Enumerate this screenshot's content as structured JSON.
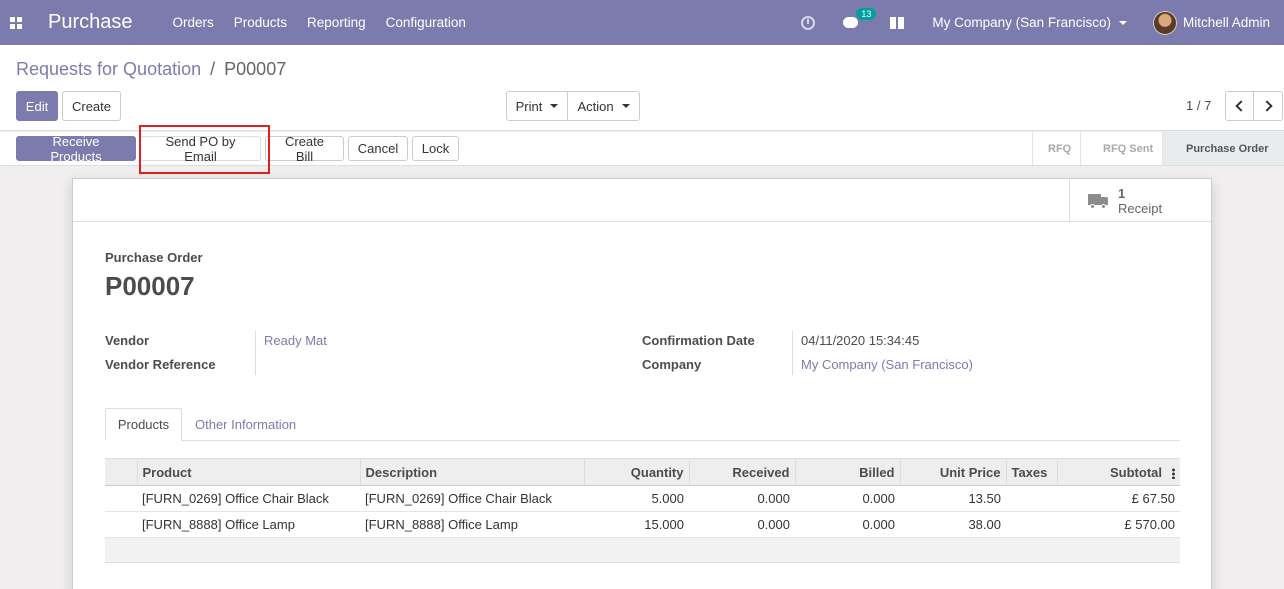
{
  "navbar": {
    "app_name": "Purchase",
    "menu": [
      "Orders",
      "Products",
      "Reporting",
      "Configuration"
    ],
    "message_count": "13",
    "company": "My Company (San Francisco)",
    "user": "Mitchell Admin",
    "bg_color": "#7c7bad",
    "icons": [
      "apps-icon",
      "clock-icon",
      "chat-icon",
      "gift-icon",
      "avatar"
    ]
  },
  "control_panel": {
    "breadcrumb_parent": "Requests for Quotation",
    "breadcrumb_separator": "/",
    "breadcrumb_current": "P00007",
    "edit_label": "Edit",
    "create_label": "Create",
    "print_label": "Print",
    "action_label": "Action",
    "pager_value": "1 / 7"
  },
  "statusbar": {
    "buttons": [
      "Receive Products",
      "Send PO by Email",
      "Create Bill",
      "Cancel",
      "Lock"
    ],
    "stages": [
      "RFQ",
      "RFQ Sent",
      "Purchase Order"
    ],
    "active_stage": "Purchase Order"
  },
  "sheet": {
    "smart_button": {
      "count": "1",
      "label": "Receipt",
      "icon": "truck-icon"
    },
    "doc_type": "Purchase Order",
    "doc_name": "P00007",
    "fields": {
      "vendor_label": "Vendor",
      "vendor_value": "Ready Mat",
      "vendor_ref_label": "Vendor Reference",
      "vendor_ref_value": "",
      "confirmation_date_label": "Confirmation Date",
      "confirmation_date_value": "04/11/2020 15:34:45",
      "company_label": "Company",
      "company_value": "My Company (San Francisco)"
    },
    "tabs": [
      "Products",
      "Other Information"
    ],
    "table": {
      "headers": [
        "Product",
        "Description",
        "Quantity",
        "Received",
        "Billed",
        "Unit Price",
        "Taxes",
        "Subtotal"
      ],
      "rows": [
        {
          "product": "[FURN_0269] Office Chair Black",
          "description": "[FURN_0269] Office Chair Black",
          "quantity": "5.000",
          "received": "0.000",
          "billed": "0.000",
          "unit_price": "13.50",
          "taxes": "",
          "subtotal": "£ 67.50"
        },
        {
          "product": "[FURN_8888] Office Lamp",
          "description": "[FURN_8888] Office Lamp",
          "quantity": "15.000",
          "received": "0.000",
          "billed": "0.000",
          "unit_price": "38.00",
          "taxes": "",
          "subtotal": "£ 570.00"
        }
      ]
    }
  }
}
